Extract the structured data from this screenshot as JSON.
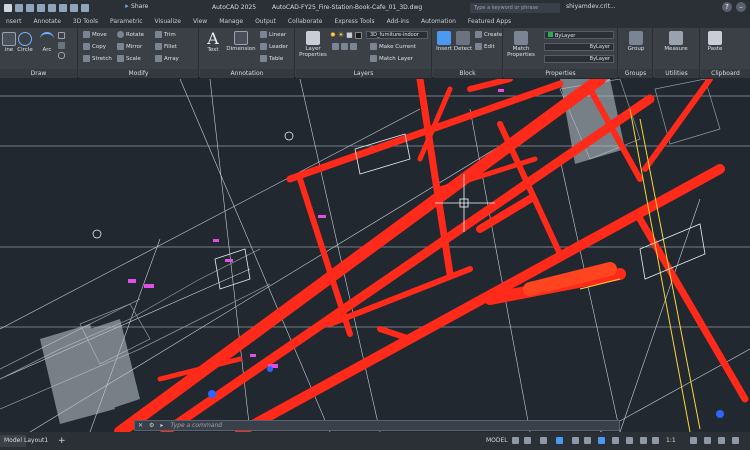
{
  "titlebar": {
    "share_label": "Share",
    "app_name": "AutoCAD 2025",
    "file_name": "AutoCAD-FY25_Fire-Station-Book-Cafe_01_3D.dwg",
    "search_placeholder": "Type a keyword or phrase",
    "user_name": "shiyamdev.crit..."
  },
  "tabs": [
    "nsert",
    "Annotate",
    "3D Tools",
    "Parametric",
    "Visualize",
    "View",
    "Manage",
    "Output",
    "Collaborate",
    "Express Tools",
    "Add-ins",
    "Automation",
    "Featured Apps"
  ],
  "ribbon": {
    "draw": {
      "label": "Draw",
      "line": "ine",
      "circle": "Circle",
      "arc": "Arc"
    },
    "modify": {
      "label": "Modify",
      "move": "Move",
      "rotate": "Rotate",
      "trim": "Trim",
      "copy": "Copy",
      "mirror": "Mirror",
      "fillet": "Fillet",
      "stretch": "Stretch",
      "scale": "Scale",
      "array": "Array"
    },
    "annotation": {
      "label": "Annotation",
      "text": "Text",
      "dimension": "Dimension",
      "linear": "Linear",
      "leader": "Leader",
      "table": "Table"
    },
    "layers": {
      "label": "Layers",
      "layer_properties_1": "Layer",
      "layer_properties_2": "Properties",
      "current_layer": "3D_furniture-indoor",
      "make_current": "Make Current",
      "match_layer": "Match Layer"
    },
    "block": {
      "label": "Block",
      "insert": "Insert",
      "detect": "Detect",
      "create": "Create",
      "edit": "Edit"
    },
    "properties": {
      "label": "Properties",
      "match_1": "Match",
      "match_2": "Properties",
      "color": "ByLayer",
      "linetype": "ByLayer",
      "lineweight": "ByLayer"
    },
    "groups": {
      "label": "Groups",
      "group": "Group"
    },
    "utilities": {
      "label": "Utilities",
      "measure": "Measure"
    },
    "clipboard": {
      "label": "Clipboard",
      "paste": "Paste"
    }
  },
  "command": {
    "placeholder": "Type a command"
  },
  "status": {
    "model_tab": "Model",
    "layout_tab": "Layout1",
    "add_tab": "+",
    "model_indicator": "MODEL",
    "scale": "1:1"
  },
  "colors": {
    "canvas_bg": "#212830",
    "geometry_red": "#ff2a1a",
    "ribbon_bg": "#3b4047",
    "accent_blue": "#4a9bf0"
  }
}
